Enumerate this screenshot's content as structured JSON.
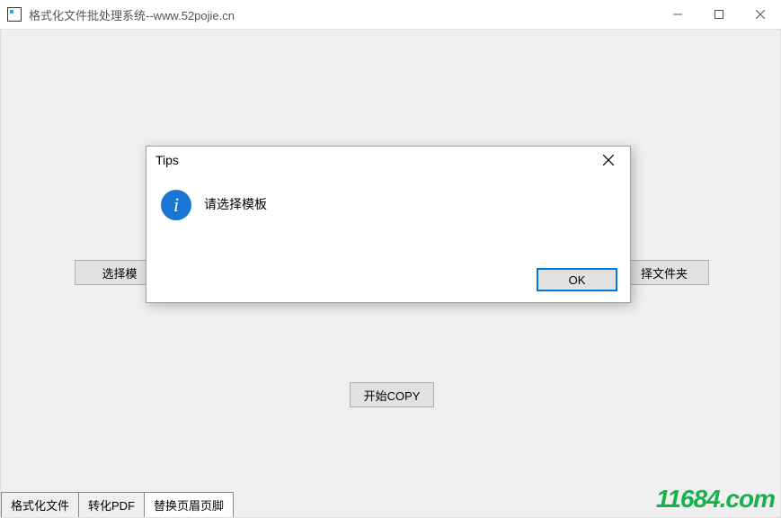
{
  "window": {
    "title": "格式化文件批处理系统--www.52pojie.cn"
  },
  "buttons": {
    "select_template": "选择模",
    "select_folder": "择文件夹",
    "start_copy": "开始COPY"
  },
  "tabs": {
    "tab1": "格式化文件",
    "tab2": "转化PDF",
    "tab3": "替换页眉页脚"
  },
  "dialog": {
    "title": "Tips",
    "message": "请选择模板",
    "ok": "OK"
  },
  "watermark": "11684.com"
}
